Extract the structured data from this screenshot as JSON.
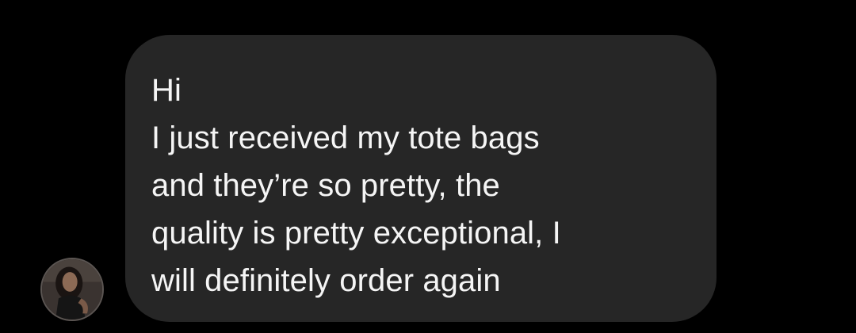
{
  "message": {
    "lines": [
      "Hi",
      "I just received my tote bags",
      "and they’re so pretty, the",
      "quality is pretty exceptional, I",
      "will definitely order again"
    ]
  },
  "sender": {
    "avatar_icon": "profile-photo-avatar"
  },
  "colors": {
    "background": "#000000",
    "bubble": "#262626",
    "text": "#f5f5f5"
  }
}
